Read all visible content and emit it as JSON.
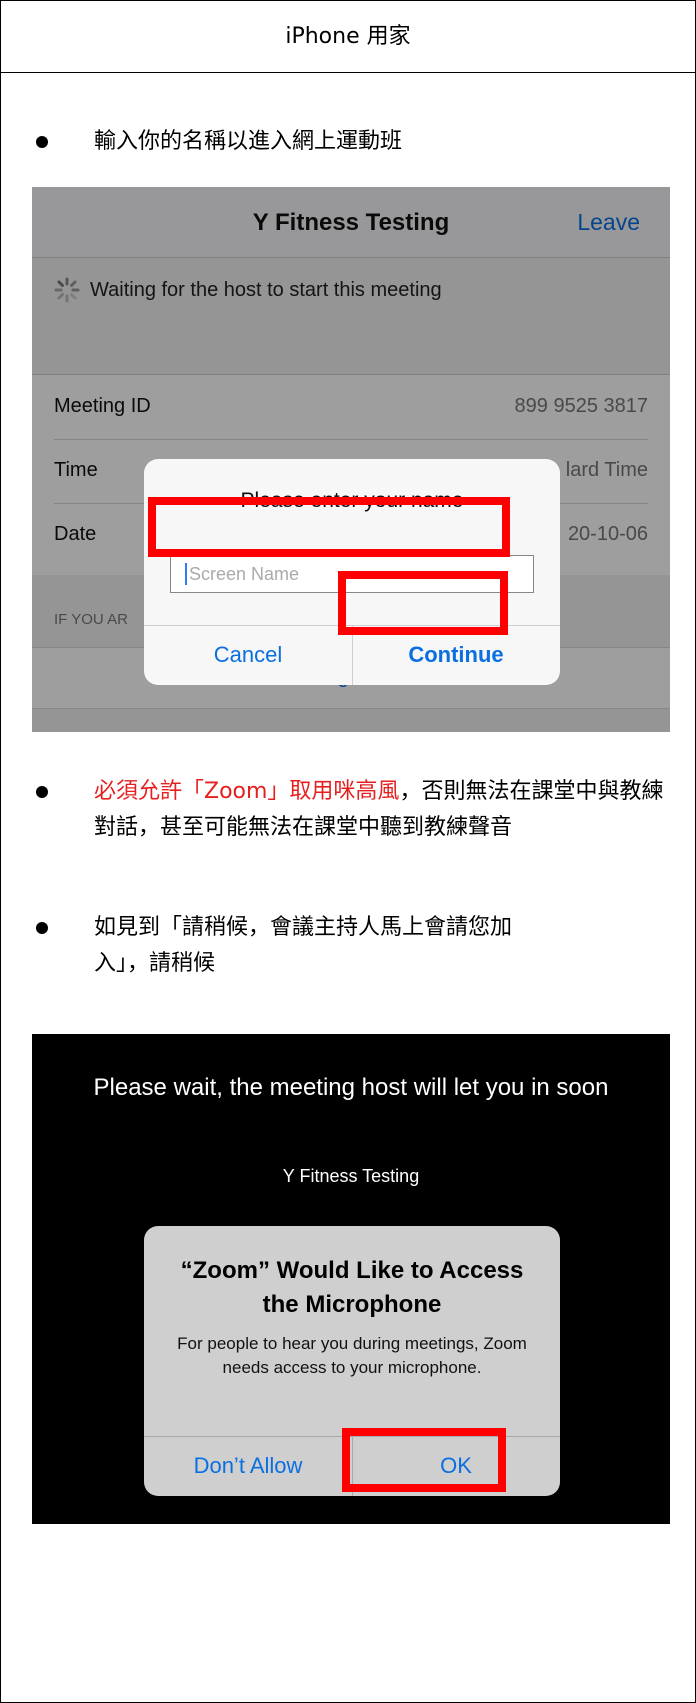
{
  "page_title": "iPhone 用家",
  "bullets": {
    "first": "輸入你的名稱以進入網上運動班",
    "second_red": "必須允許「Zoom」取用咪高風",
    "second_rest": "，否則無法在課堂中與教練對話，甚至可能無法在課堂中聽到教練聲音",
    "third": "如見到「請稍候，會議主持人馬上會請您加入」，請稍候"
  },
  "screen1": {
    "meeting_title": "Y Fitness Testing",
    "leave_label": "Leave",
    "waiting_text": "Waiting for the host to start this meeting",
    "rows": [
      {
        "key": "Meeting ID",
        "value": "899 9525 3817"
      },
      {
        "key": "Time",
        "value": "lard Time"
      },
      {
        "key": "Date",
        "value": "20-10-06"
      }
    ],
    "note_text": "IF YOU AR",
    "sign_in_label": "Sign In",
    "dialog": {
      "prompt": "Please enter your name",
      "input_placeholder": "Screen Name",
      "cancel_label": "Cancel",
      "continue_label": "Continue"
    }
  },
  "screen2": {
    "wait_message": "Please wait, the meeting host will let you in soon",
    "meeting_name": "Y Fitness Testing",
    "dialog": {
      "title": "“Zoom” Would Like to Access the Microphone",
      "message": "For people to hear you during meetings, Zoom needs access to your microphone.",
      "dont_allow_label": "Don’t Allow",
      "ok_label": "OK"
    }
  },
  "colors": {
    "highlight": "#ff0000",
    "ios_blue": "#0a6fe0",
    "red_text": "#e62020"
  }
}
